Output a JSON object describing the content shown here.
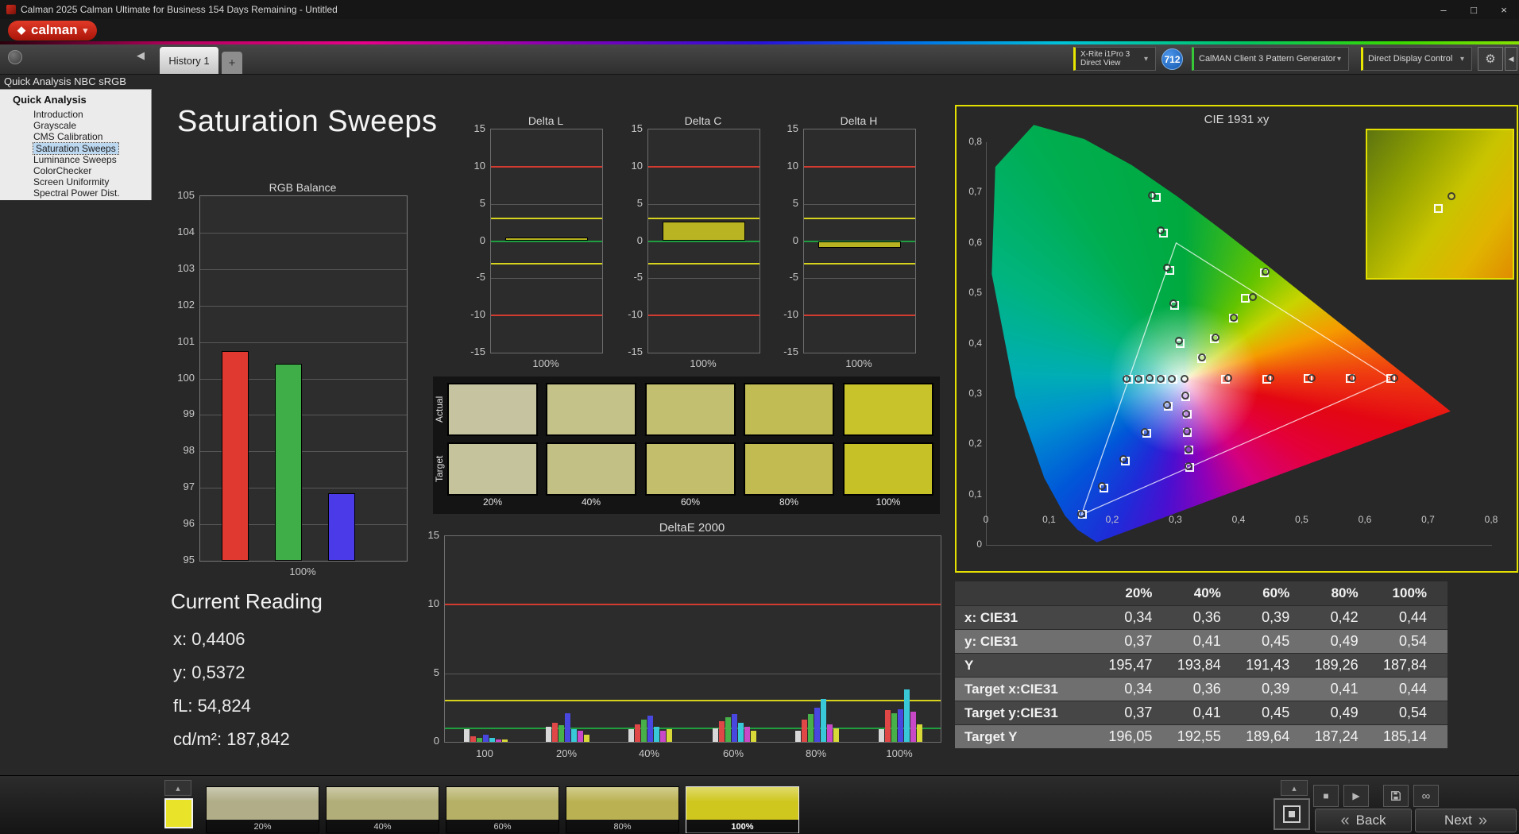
{
  "window": {
    "title": "Calman 2025 Calman Ultimate for Business 154 Days Remaining  - Untitled",
    "controls": {
      "minimize": "–",
      "maximize": "□",
      "close": "×"
    }
  },
  "brand": {
    "logo": "calman"
  },
  "tabs": {
    "active": "History 1",
    "add": "+"
  },
  "devices": {
    "meter": {
      "line1": "X-Rite i1Pro 3",
      "line2": "Direct View"
    },
    "badge": "712",
    "pattern": "CalMAN Client 3 Pattern Generator",
    "display": "Direct Display Control"
  },
  "sidebar": {
    "header": "Quick Analysis NBC sRGB",
    "root": "Quick Analysis",
    "items": [
      "Introduction",
      "Grayscale",
      "CMS Calibration",
      "Saturation Sweeps",
      "Luminance Sweeps",
      "ColorChecker",
      "Screen Uniformity",
      "Spectral Power Dist."
    ],
    "selected_index": 3
  },
  "page_title": "Saturation Sweeps",
  "rgb_balance": {
    "title": "RGB Balance",
    "xlabel": "100%",
    "ymin": 95,
    "ymax": 105,
    "ystep": 1,
    "bars": [
      {
        "name": "red",
        "value": 100.75,
        "color": "#e03a30"
      },
      {
        "name": "green",
        "value": 100.4,
        "color": "#3fae49"
      },
      {
        "name": "blue",
        "value": 96.85,
        "color": "#4a3ae8"
      }
    ]
  },
  "delta_charts": {
    "ymin": -15,
    "ymax": 15,
    "ystep": 5,
    "xlabel": "100%",
    "limit_red": 10,
    "limit_yellow": 3,
    "bar_color": "#b9b421",
    "charts": [
      {
        "title": "Delta L",
        "value": 0.5
      },
      {
        "title": "Delta C",
        "value": 2.6
      },
      {
        "title": "Delta H",
        "value": -0.9
      }
    ]
  },
  "saturation_swatches": {
    "row_labels": [
      "Actual",
      "Target"
    ],
    "percent_labels": [
      "20%",
      "40%",
      "60%",
      "80%",
      "100%"
    ],
    "actual_colors": [
      "#c6c4a0",
      "#c4c189",
      "#c3bf70",
      "#c2bc55",
      "#c8c32b"
    ],
    "target_colors": [
      "#c5c39c",
      "#c3c085",
      "#c2be6c",
      "#c1bb51",
      "#c6c127"
    ]
  },
  "deltae": {
    "title": "DeltaE 2000",
    "ymin": 0,
    "ymax": 15,
    "ystep": 5,
    "limit_red": 10,
    "limit_yellow": 3,
    "limit_green": 1,
    "xlabels": [
      "100",
      "20%",
      "40%",
      "60%",
      "80%",
      "100%"
    ],
    "series_colors": [
      "#d8d8d8",
      "#e04848",
      "#48b048",
      "#4848e0",
      "#38c8d8",
      "#c848c8",
      "#d8d838"
    ],
    "clusters": [
      [
        0.9,
        0.4,
        0.3,
        0.5,
        0.3,
        0.2,
        0.2
      ],
      [
        1.1,
        1.4,
        1.2,
        2.1,
        0.9,
        0.8,
        0.5
      ],
      [
        0.9,
        1.3,
        1.6,
        1.9,
        1.1,
        0.8,
        0.9
      ],
      [
        1.0,
        1.5,
        1.8,
        2.0,
        1.4,
        1.1,
        0.8
      ],
      [
        0.8,
        1.6,
        2.0,
        2.5,
        3.1,
        1.3,
        1.0
      ],
      [
        0.9,
        2.3,
        2.1,
        2.4,
        3.8,
        2.2,
        1.3
      ]
    ]
  },
  "current_reading": {
    "title": "Current Reading",
    "x": "x: 0,4406",
    "y": "y: 0,5372",
    "fl": "fL: 54,824",
    "cdm2": "cd/m²: 187,842"
  },
  "cie": {
    "title": "CIE 1931 xy",
    "xlabels": [
      "0",
      "0,1",
      "0,2",
      "0,3",
      "0,4",
      "0,5",
      "0,6",
      "0,7",
      "0,8"
    ],
    "ylabels": [
      "0,8",
      "0,7",
      "0,6",
      "0,5",
      "0,4",
      "0,3",
      "0,2",
      "0,1",
      "0"
    ],
    "squares": [
      [
        0.378,
        0.329
      ],
      [
        0.444,
        0.329
      ],
      [
        0.509,
        0.33
      ],
      [
        0.575,
        0.33
      ],
      [
        0.64,
        0.33
      ],
      [
        0.306,
        0.4
      ],
      [
        0.298,
        0.475
      ],
      [
        0.29,
        0.545
      ],
      [
        0.28,
        0.62
      ],
      [
        0.268,
        0.69
      ],
      [
        0.287,
        0.275
      ],
      [
        0.253,
        0.221
      ],
      [
        0.219,
        0.167
      ],
      [
        0.186,
        0.113
      ],
      [
        0.152,
        0.06
      ],
      [
        0.295,
        0.329
      ],
      [
        0.277,
        0.329
      ],
      [
        0.26,
        0.329
      ],
      [
        0.242,
        0.329
      ],
      [
        0.225,
        0.329
      ],
      [
        0.315,
        0.294
      ],
      [
        0.317,
        0.259
      ],
      [
        0.318,
        0.224
      ],
      [
        0.32,
        0.189
      ],
      [
        0.321,
        0.154
      ],
      [
        0.34,
        0.37
      ],
      [
        0.36,
        0.41
      ],
      [
        0.39,
        0.45
      ],
      [
        0.41,
        0.49
      ],
      [
        0.44,
        0.54
      ]
    ],
    "circles": [
      [
        0.313,
        0.329
      ],
      [
        0.382,
        0.331
      ],
      [
        0.449,
        0.332
      ],
      [
        0.514,
        0.331
      ],
      [
        0.578,
        0.332
      ],
      [
        0.645,
        0.331
      ],
      [
        0.304,
        0.405
      ],
      [
        0.295,
        0.48
      ],
      [
        0.286,
        0.55
      ],
      [
        0.276,
        0.625
      ],
      [
        0.262,
        0.695
      ],
      [
        0.285,
        0.277
      ],
      [
        0.25,
        0.224
      ],
      [
        0.216,
        0.17
      ],
      [
        0.183,
        0.116
      ],
      [
        0.15,
        0.062
      ],
      [
        0.293,
        0.33
      ],
      [
        0.275,
        0.33
      ],
      [
        0.258,
        0.331
      ],
      [
        0.24,
        0.33
      ],
      [
        0.222,
        0.33
      ],
      [
        0.314,
        0.296
      ],
      [
        0.316,
        0.26
      ],
      [
        0.317,
        0.226
      ],
      [
        0.319,
        0.19
      ],
      [
        0.32,
        0.156
      ],
      [
        0.341,
        0.372
      ],
      [
        0.362,
        0.412
      ],
      [
        0.391,
        0.452
      ],
      [
        0.421,
        0.492
      ],
      [
        0.442,
        0.543
      ]
    ]
  },
  "table": {
    "headers": [
      "20%",
      "40%",
      "60%",
      "80%",
      "100%"
    ],
    "rows": [
      {
        "label": "x: CIE31",
        "values": [
          "0,34",
          "0,36",
          "0,39",
          "0,42",
          "0,44"
        ]
      },
      {
        "label": "y: CIE31",
        "values": [
          "0,37",
          "0,41",
          "0,45",
          "0,49",
          "0,54"
        ]
      },
      {
        "label": "Y",
        "values": [
          "195,47",
          "193,84",
          "191,43",
          "189,26",
          "187,84"
        ]
      },
      {
        "label": "Target x:CIE31",
        "values": [
          "0,34",
          "0,36",
          "0,39",
          "0,41",
          "0,44"
        ]
      },
      {
        "label": "Target y:CIE31",
        "values": [
          "0,37",
          "0,41",
          "0,45",
          "0,49",
          "0,54"
        ]
      },
      {
        "label": "Target Y",
        "values": [
          "196,05",
          "192,55",
          "189,64",
          "187,24",
          "185,14"
        ]
      }
    ]
  },
  "bottom": {
    "swatches": [
      {
        "label": "20%",
        "color": "#b0ad88",
        "selected": false
      },
      {
        "label": "40%",
        "color": "#b2ae79",
        "selected": false
      },
      {
        "label": "60%",
        "color": "#b5b065",
        "selected": false
      },
      {
        "label": "80%",
        "color": "#bab252",
        "selected": false
      },
      {
        "label": "100%",
        "color": "#cfc71e",
        "selected": true
      }
    ],
    "back": "Back",
    "next": "Next",
    "back_chevron": "«",
    "next_chevron": "»"
  }
}
